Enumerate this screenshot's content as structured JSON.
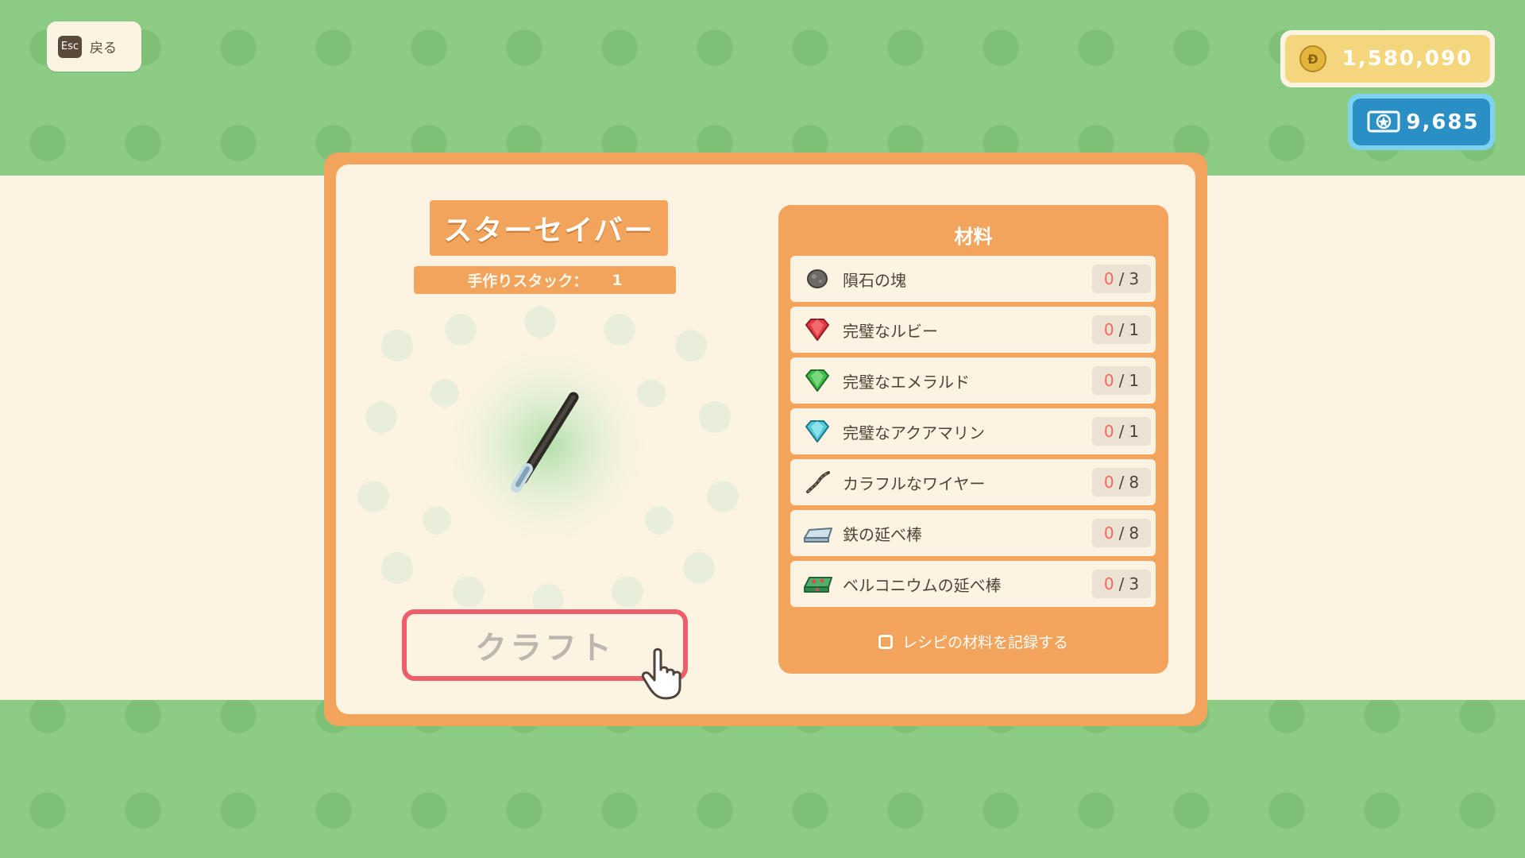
{
  "header": {
    "back_key": "Esc",
    "back_label": "戻る"
  },
  "currency": {
    "coins": "1,580,090",
    "coin_icon": "coin-icon",
    "tickets": "9,685",
    "ticket_icon": "ticket-icon"
  },
  "recipe": {
    "item_name": "スターセイバー",
    "stack_label": "手作りスタック：",
    "stack_value": "1",
    "item_icon": "star-saber-icon",
    "craft_label": "クラフト"
  },
  "materials": {
    "title": "材料",
    "items": [
      {
        "name": "隕石の塊",
        "owned": "0",
        "sep": "/",
        "required": "3",
        "icon": "meteorite-icon"
      },
      {
        "name": "完璧なルビー",
        "owned": "0",
        "sep": "/",
        "required": "1",
        "icon": "ruby-icon"
      },
      {
        "name": "完璧なエメラルド",
        "owned": "0",
        "sep": "/",
        "required": "1",
        "icon": "emerald-icon"
      },
      {
        "name": "完璧なアクアマリン",
        "owned": "0",
        "sep": "/",
        "required": "1",
        "icon": "aquamarine-icon"
      },
      {
        "name": "カラフルなワイヤー",
        "owned": "0",
        "sep": "/",
        "required": "8",
        "icon": "wire-icon"
      },
      {
        "name": "鉄の延べ棒",
        "owned": "0",
        "sep": "/",
        "required": "8",
        "icon": "iron-bar-icon"
      },
      {
        "name": "ベルコニウムの延べ棒",
        "owned": "0",
        "sep": "/",
        "required": "3",
        "icon": "belconium-bar-icon"
      }
    ],
    "record_label": "レシピの材料を記録する",
    "record_checked": false
  },
  "colors": {
    "accent_orange": "#f2a45c",
    "background_green": "#8ccb84",
    "cream": "#fdf3e3",
    "craft_border": "#ee5d6a",
    "owned_count": "#ee6a5a",
    "ticket_blue": "#2a8fc4",
    "coin_yellow": "#f4d77d"
  }
}
